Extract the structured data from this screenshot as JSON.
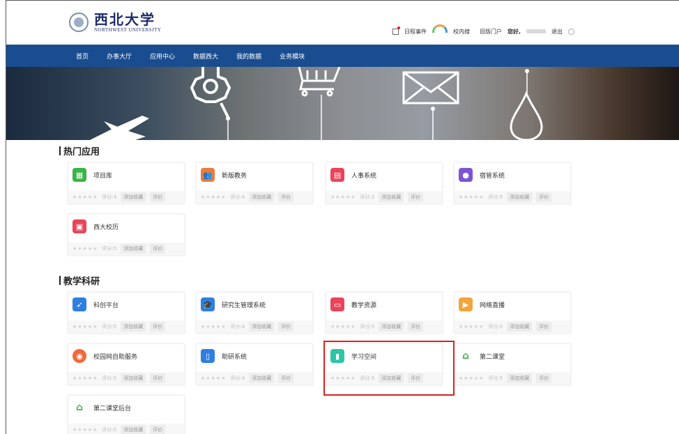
{
  "header": {
    "logo_cn": "西北大学",
    "logo_en": "NORTHWEST UNIVERSITY",
    "links": {
      "events": "日程事件",
      "search": "校内搜",
      "old_portal": "旧版门户",
      "greeting": "您好,",
      "logout": "退出"
    }
  },
  "nav": {
    "items": [
      "首页",
      "办事大厅",
      "应用中心",
      "数据西大",
      "我的数据",
      "业务模块"
    ]
  },
  "sections": [
    {
      "title": "热门应用",
      "apps": [
        {
          "name": "项目库",
          "score": "评分:4",
          "color": "#3cb34a",
          "icon": "grid-icon"
        },
        {
          "name": "新版教务",
          "score": "评分:4",
          "color": "#ef7a3a",
          "icon": "people-icon"
        },
        {
          "name": "人事系统",
          "score": "评分:2",
          "color": "#e9445a",
          "icon": "document-icon"
        },
        {
          "name": "宿管系统",
          "score": "评分:5",
          "color": "#7b55d6",
          "icon": "user-icon"
        },
        {
          "name": "西大校历",
          "score": "评分:5",
          "color": "#e9445a",
          "icon": "calendar-icon"
        }
      ]
    },
    {
      "title": "教学科研",
      "apps": [
        {
          "name": "科创平台",
          "score": "评分:5",
          "color": "#2f7fe0",
          "icon": "rocket-icon"
        },
        {
          "name": "研究生管理系统",
          "score": "评分:4",
          "color": "#2f7fe0",
          "icon": "graduation-cap-icon"
        },
        {
          "name": "教学资源",
          "score": "评分:5",
          "color": "#e9445a",
          "icon": "book-icon"
        },
        {
          "name": "网络直播",
          "score": "评分:5",
          "color": "#f2a53a",
          "icon": "tv-icon"
        },
        {
          "name": "校园网自助服务",
          "score": "评分:5",
          "color": "#ef6a3a",
          "icon": "globe-icon"
        },
        {
          "name": "助研系统",
          "score": "评分:4",
          "color": "#2f7fe0",
          "icon": "notebook-icon"
        },
        {
          "name": "学习空间",
          "score": "评分:5",
          "color": "#2ec4a8",
          "icon": "bookmark-icon"
        },
        {
          "name": "第二课堂",
          "score": "评分:5",
          "color": "#3cb34a",
          "icon": "classroom-icon"
        },
        {
          "name": "第二课堂后台",
          "score": "评分:5",
          "color": "#3cb34a",
          "icon": "classroom-icon"
        }
      ]
    }
  ],
  "card_labels": {
    "stars": "★★★★★",
    "favorite": "添加收藏",
    "rate": "评价"
  },
  "colors": {
    "nav_bg": "#1a4d8f",
    "highlight": "#d9211f"
  }
}
